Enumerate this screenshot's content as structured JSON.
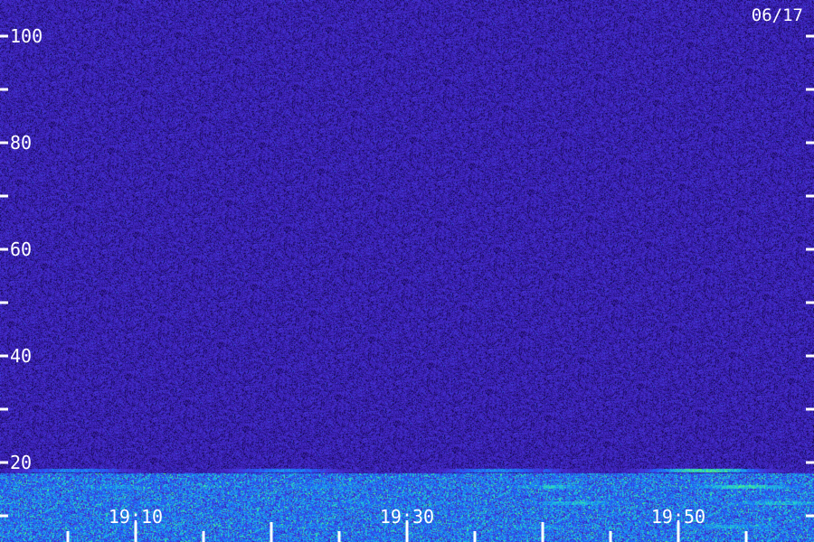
{
  "chart_data": {
    "type": "heatmap",
    "title": "",
    "xlabel": "",
    "ylabel": "",
    "date_label": "06/17",
    "x_range_minutes": [
      "19:00",
      "20:00"
    ],
    "xlim": [
      "19:00",
      "20:00"
    ],
    "ylim": [
      0,
      102
    ],
    "y_ticks_labeled": [
      20,
      40,
      60,
      80,
      100
    ],
    "y_ticks_minor": [
      10,
      30,
      50,
      70,
      90
    ],
    "x_tick_labels": [
      "19:10",
      "19:30",
      "19:50"
    ],
    "x_ticks_minutes": [
      5,
      10,
      15,
      20,
      25,
      30,
      35,
      40,
      45,
      50,
      55
    ],
    "grid": false,
    "colormap": [
      "#0a0224",
      "#2a1490",
      "#4a2cd0",
      "#1a6cff",
      "#20d0d8",
      "#60ff60"
    ],
    "bands": [
      {
        "name": "noise floor",
        "y_from": 0,
        "y_to": 102,
        "intensity": 0.28
      },
      {
        "name": "low band",
        "y_from": 0,
        "y_to": 18,
        "intensity": 0.6
      },
      {
        "name": "line",
        "y": 18.5,
        "intensity": 0.9
      },
      {
        "name": "line",
        "y": 15.5,
        "intensity": 0.85
      },
      {
        "name": "line",
        "y": 12.5,
        "intensity": 0.75
      },
      {
        "name": "line",
        "y": 8,
        "intensity": 0.7
      },
      {
        "name": "line",
        "y": 3.5,
        "intensity": 0.7
      }
    ]
  }
}
